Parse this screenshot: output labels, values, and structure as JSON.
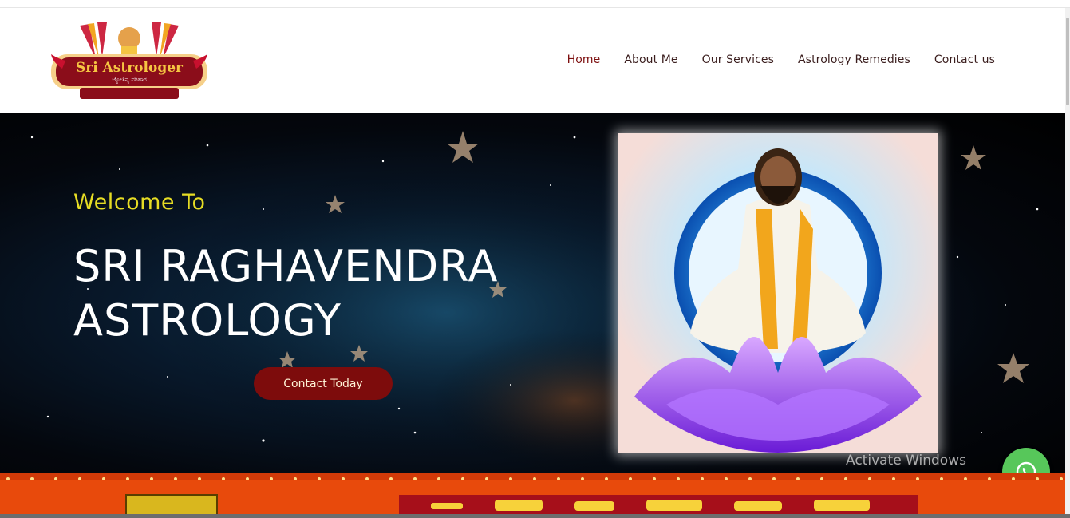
{
  "brand": {
    "name": "Sri Astrologer",
    "tagline": "ಜ್ಯೋತಿಷ್ಯ ಪರಿಹಾರ"
  },
  "nav": {
    "items": [
      {
        "label": "Home"
      },
      {
        "label": "About Me"
      },
      {
        "label": "Our Services"
      },
      {
        "label": "Astrology Remedies"
      },
      {
        "label": "Contact us"
      }
    ]
  },
  "hero": {
    "welcome": "Welcome To",
    "title_line1": "SRI RAGHAVENDRA",
    "title_line2": "ASTROLOGY",
    "cta_label": "Contact Today"
  },
  "system": {
    "activate_windows": "Activate Windows"
  },
  "icons": {
    "whatsapp": "whatsapp-icon"
  },
  "colors": {
    "accent_maroon": "#7d0c0c",
    "welcome_yellow": "#e6dc24",
    "whatsapp_green": "#57c75a",
    "banner_orange": "#e84a0c"
  }
}
